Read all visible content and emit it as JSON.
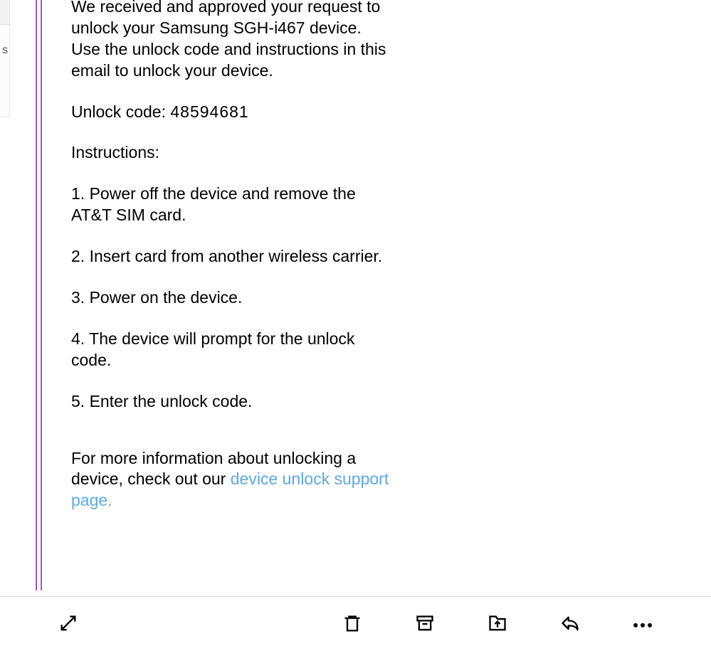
{
  "email": {
    "intro": "We received and approved your request to unlock your Samsung SGH-i467 device. Use the unlock code and instructions in this email to unlock your device.",
    "unlock_code_label": "Unlock code:",
    "unlock_code_value": "48594681",
    "instructions_heading": "Instructions:",
    "steps": [
      "1. Power off the device and remove the AT&T SIM card.",
      "2. Insert card from another wireless carrier.",
      "3. Power on the device.",
      "4. The device will prompt for the unlock code.",
      "5. Enter the unlock code."
    ],
    "more_info_prefix": "For more information about unlocking a device, check out our ",
    "more_info_link": "device unlock support page."
  },
  "left_fragment": "s",
  "toolbar": {
    "expand": "expand-icon",
    "delete": "delete-icon",
    "archive": "archive-icon",
    "move": "move-icon",
    "reply": "reply-icon",
    "more": "more-icon"
  }
}
